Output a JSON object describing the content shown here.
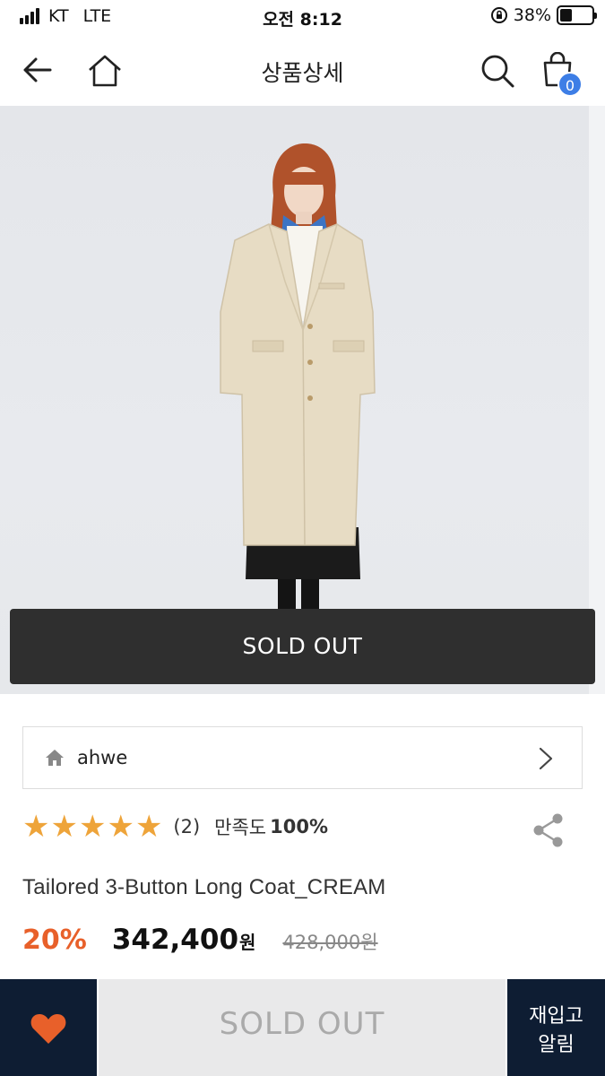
{
  "status_bar": {
    "carrier": "KT",
    "network": "LTE",
    "time": "오전 8:12",
    "battery": "38%",
    "battery_level": 0.38
  },
  "header": {
    "title": "상품상세",
    "cart_count": "0"
  },
  "hero": {
    "overlay_label": "SOLD OUT"
  },
  "brand": {
    "name": "ahwe"
  },
  "rating": {
    "stars": 5,
    "review_count": "(2)",
    "satisfaction_label": "만족도",
    "satisfaction_value": "100%"
  },
  "product": {
    "name": "Tailored 3-Button Long Coat_CREAM",
    "discount": "20%",
    "price": "342,400",
    "currency": "원",
    "original_price": "428,000원"
  },
  "bottom_bar": {
    "soldout_label": "SOLD OUT",
    "restock_line1": "재입고",
    "restock_line2": "알림"
  },
  "colors": {
    "accent": "#e8602a",
    "star": "#eea43a",
    "navy": "#0e1d33",
    "badge": "#3d7ee6"
  }
}
